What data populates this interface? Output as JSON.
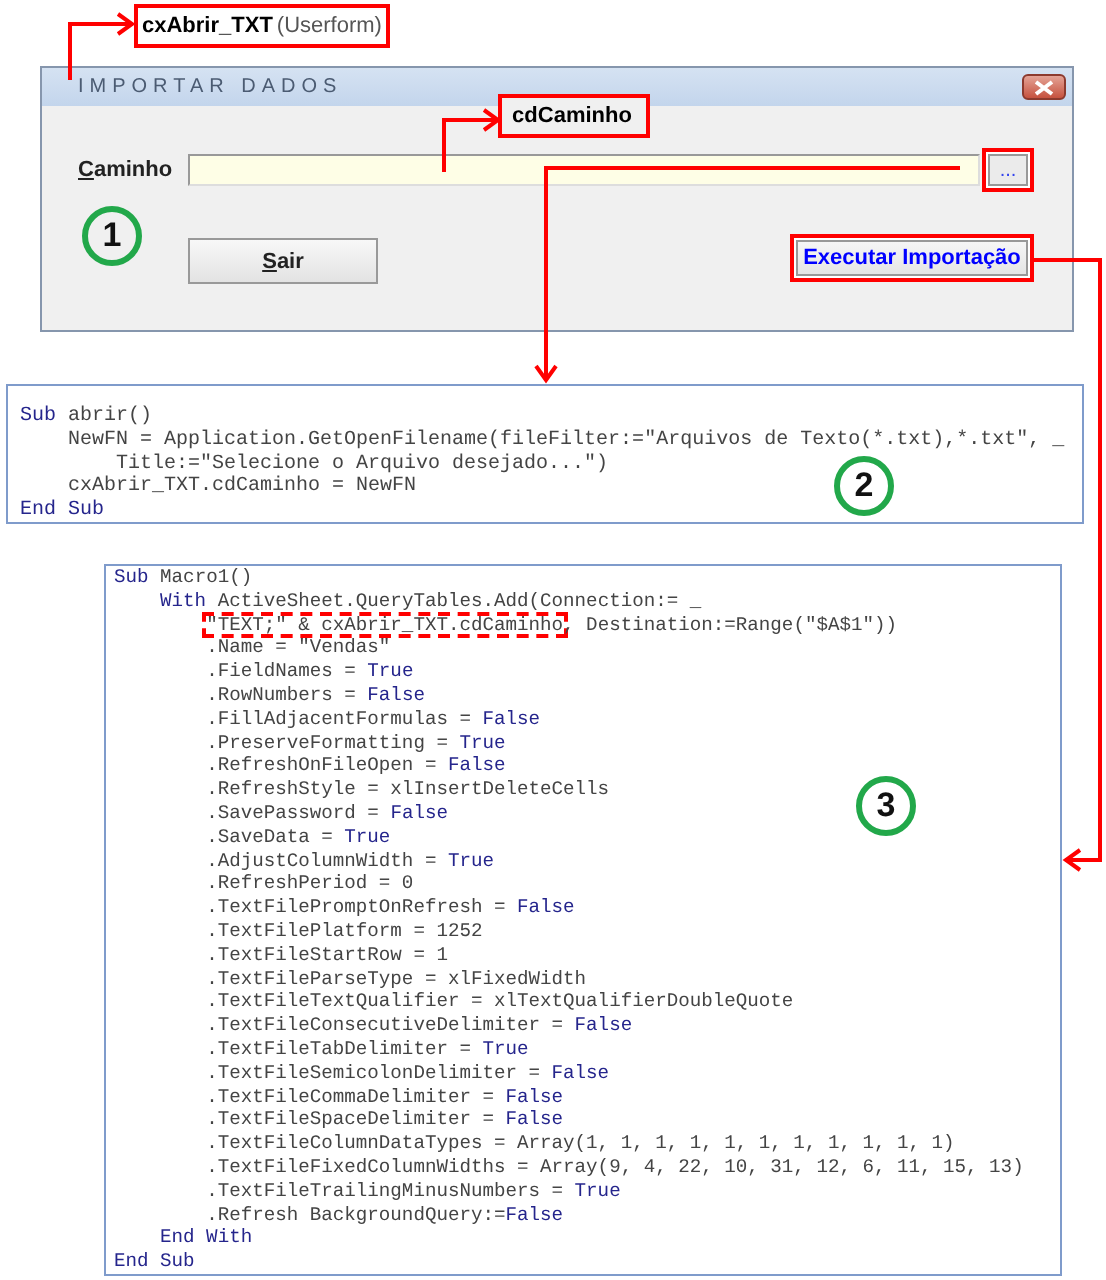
{
  "callouts": [
    {
      "text": "**cxAbrir_TXT**(Userform)"
    },
    {
      "text": "**cdCaminho**"
    }
  ],
  "form": {
    "title": "IMPORTAR DADOS",
    "step": "1",
    "path_label": "Caminho",
    "browse_button": {
      "label": "...",
      "highlighted": true
    },
    "exit_button": {
      "label": "Sair"
    },
    "run_button": {
      "label": "Executar Importação",
      "highlighted": true
    }
  },
  "code_blocks": [
    {
      "step": "2",
      "lines": [
        [
          {
            "kind": "keyword",
            "text": "Sub"
          },
          {
            "kind": "code",
            "text": " abrir()"
          }
        ],
        [
          {
            "kind": "code",
            "text": "    NewFN = Application.GetOpenFilename(fileFilter:=\"Arquivos de Texto(*.txt),*.txt\", _"
          }
        ],
        [
          {
            "kind": "code",
            "text": "        Title:=\"Selecione o Arquivo desejado...\")"
          }
        ],
        [
          {
            "kind": "code",
            "text": "    cxAbrir_TXT.cdCaminho = NewFN"
          }
        ],
        [
          {
            "kind": "keyword",
            "text": "End Sub"
          }
        ]
      ]
    },
    {
      "step": "3",
      "lines": [
        [
          {
            "kind": "keyword",
            "text": "Sub"
          },
          {
            "kind": "code",
            "text": " Macro1()"
          }
        ],
        [
          {
            "kind": "keyword",
            "text": "    With"
          },
          {
            "kind": "code",
            "text": " ActiveSheet.QueryTables.Add(Connection:= _"
          }
        ],
        [
          {
            "kind": "highlight",
            "text": "        \"TEXT;\" & cxAbrir_TXT.cdCaminho"
          },
          {
            "kind": "code",
            "text": ", Destination:=Range(\"$A$1\"))"
          }
        ],
        [
          {
            "kind": "code",
            "text": "        .Name = \"Vendas\""
          }
        ],
        [
          {
            "kind": "code",
            "text": "        .FieldNames = "
          },
          {
            "kind": "keyword",
            "text": "True"
          }
        ],
        [
          {
            "kind": "code",
            "text": "        .RowNumbers = "
          },
          {
            "kind": "keyword",
            "text": "False"
          }
        ],
        [
          {
            "kind": "code",
            "text": "        .FillAdjacentFormulas = "
          },
          {
            "kind": "keyword",
            "text": "False"
          }
        ],
        [
          {
            "kind": "code",
            "text": "        .PreserveFormatting = "
          },
          {
            "kind": "keyword",
            "text": "True"
          }
        ],
        [
          {
            "kind": "code",
            "text": "        .RefreshOnFileOpen = "
          },
          {
            "kind": "keyword",
            "text": "False"
          }
        ],
        [
          {
            "kind": "code",
            "text": "        .RefreshStyle = xlInsertDeleteCells"
          }
        ],
        [
          {
            "kind": "code",
            "text": "        .SavePassword = "
          },
          {
            "kind": "keyword",
            "text": "False"
          }
        ],
        [
          {
            "kind": "code",
            "text": "        .SaveData = "
          },
          {
            "kind": "keyword",
            "text": "True"
          }
        ],
        [
          {
            "kind": "code",
            "text": "        .AdjustColumnWidth = "
          },
          {
            "kind": "keyword",
            "text": "True"
          }
        ],
        [
          {
            "kind": "code",
            "text": "        .RefreshPeriod = 0"
          }
        ],
        [
          {
            "kind": "code",
            "text": "        .TextFilePromptOnRefresh = "
          },
          {
            "kind": "keyword",
            "text": "False"
          }
        ],
        [
          {
            "kind": "code",
            "text": "        .TextFilePlatform = 1252"
          }
        ],
        [
          {
            "kind": "code",
            "text": "        .TextFileStartRow = 1"
          }
        ],
        [
          {
            "kind": "code",
            "text": "        .TextFileParseType = xlFixedWidth"
          }
        ],
        [
          {
            "kind": "code",
            "text": "        .TextFileTextQualifier = xlTextQualifierDoubleQuote"
          }
        ],
        [
          {
            "kind": "code",
            "text": "        .TextFileConsecutiveDelimiter = "
          },
          {
            "kind": "keyword",
            "text": "False"
          }
        ],
        [
          {
            "kind": "code",
            "text": "        .TextFileTabDelimiter = "
          },
          {
            "kind": "keyword",
            "text": "True"
          }
        ],
        [
          {
            "kind": "code",
            "text": "        .TextFileSemicolonDelimiter = "
          },
          {
            "kind": "keyword",
            "text": "False"
          }
        ],
        [
          {
            "kind": "code",
            "text": "        .TextFileCommaDelimiter = "
          },
          {
            "kind": "keyword",
            "text": "False"
          }
        ],
        [
          {
            "kind": "code",
            "text": "        .TextFileSpaceDelimiter = "
          },
          {
            "kind": "keyword",
            "text": "False"
          }
        ],
        [
          {
            "kind": "code",
            "text": "        .TextFileColumnDataTypes = Array(1, 1, 1, 1, 1, 1, 1, 1, 1, 1, 1)"
          }
        ],
        [
          {
            "kind": "code",
            "text": "        .TextFileFixedColumnWidths = Array(9, 4, 22, 10, 31, 12, 6, 11, 15, 13)"
          }
        ],
        [
          {
            "kind": "code",
            "text": "        .TextFileTrailingMinusNumbers = "
          },
          {
            "kind": "keyword",
            "text": "True"
          }
        ],
        [
          {
            "kind": "code",
            "text": "        .Refresh BackgroundQuery:="
          },
          {
            "kind": "keyword",
            "text": "False"
          }
        ],
        [
          {
            "kind": "keyword",
            "text": "    End With"
          }
        ],
        [
          {
            "kind": "keyword",
            "text": "End Sub"
          }
        ]
      ]
    }
  ]
}
